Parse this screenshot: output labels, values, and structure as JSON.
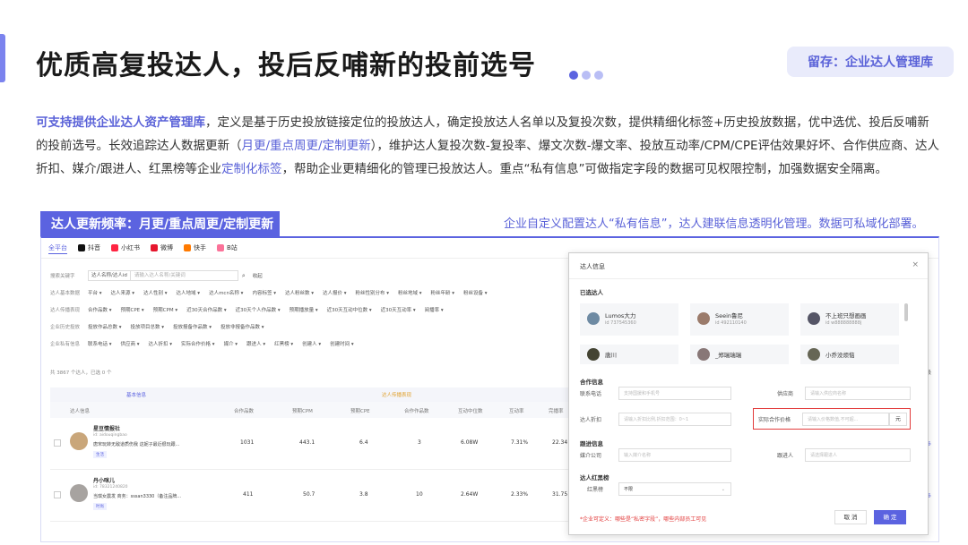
{
  "header": {
    "title": "优质高复投达人，投后反哺新的投前选号",
    "tag": "留存：企业达人管理库",
    "accent_color": "#5b63e0"
  },
  "description": {
    "p1_hl": "可支持提供企业达人资产管理库",
    "p1": "，定义是基于历史投放链接定位的投放达人，确定投放达人名单以及复投次数，提供精细化标签+历史投放数据，优中选优、投后反哺新的投前选号。长效追踪达人数据更新（",
    "p2_hl": "月更/重点周更/定制更新",
    "p2": "），维护达人复投次数-复投率、爆文次数-爆文率、投放互动率/CPM/CPE评估效果好坏、合作供应商、达人折扣、媒介/跟进人、红黑榜等企业",
    "p3_hl": "定制化标签",
    "p3": "，帮助企业更精细化的管理已投放达人。重点“私有信息”可做指定字段的数据可见权限控制，加强数据安全隔离。"
  },
  "section_label": "达人更新频率：月更/重点周更/定制更新",
  "right_caption": "企业自定义配置达人“私有信息”，达人建联信息透明化管理。数据可私域化部署。",
  "app": {
    "tabs": [
      {
        "label": "全平台",
        "icon": "all-icon",
        "color": ""
      },
      {
        "label": "抖音",
        "icon": "douyin-icon",
        "color": "#111111"
      },
      {
        "label": "小红书",
        "icon": "xiaohongshu-icon",
        "color": "#ff2442"
      },
      {
        "label": "微博",
        "icon": "weibo-icon",
        "color": "#e6162d"
      },
      {
        "label": "快手",
        "icon": "kuaishou-icon",
        "color": "#ff7a00"
      },
      {
        "label": "B站",
        "icon": "bilibili-icon",
        "color": "#fb7299"
      }
    ],
    "search": {
      "row_label": "搜索关键字",
      "select": "达人名称/达人id",
      "placeholder": "请输入达人名称/关键词",
      "advanced": "收起"
    },
    "filter_rows": [
      {
        "label": "达人基本数据",
        "items": [
          "平台",
          "达人来源",
          "达人性别",
          "达人地域",
          "达人mcn名称",
          "内容标签",
          "达人粉丝数",
          "达人报价",
          "粉丝性别分布",
          "粉丝地域",
          "粉丝年龄",
          "粉丝设备"
        ]
      },
      {
        "label": "达人传播表现",
        "items": [
          "合作品数",
          "预期CPE",
          "预期CPM",
          "近30天合作品数",
          "近30天个人作品数",
          "预期播放量",
          "近30天互动中位数",
          "近30天互动率",
          "阅播率"
        ]
      },
      {
        "label": "企业历史投放",
        "items": [
          "投放作品总数",
          "投放项目总数",
          "投放报备作品数",
          "投放非报备作品数"
        ]
      },
      {
        "label": "企业私有信息",
        "items": [
          "联系电话",
          "供应商",
          "达人折扣",
          "实际合作价格",
          "媒介",
          "跟进人",
          "红黑榜",
          "创建人",
          "创建时间"
        ]
      }
    ],
    "count": "共 3867 个达人，已选 0 个",
    "table": {
      "group1": "基本信息",
      "group2": "达人传播表现",
      "headers": [
        "达人信息",
        "合作品数",
        "预期CPM",
        "预期CPE",
        "合作作品数",
        "互动中位数",
        "互动率",
        "完播率"
      ],
      "rows": [
        {
          "name": "星豆情报社",
          "id": "id: aidouqingbao",
          "bio": "唐宋玩转无敌道质伤我 这妮子最近很玩跟...",
          "badge": "生活",
          "values": [
            "1031",
            "443.1",
            "6.4",
            "3",
            "6.08W",
            "7.31%",
            "22.34"
          ]
        },
        {
          "name": "丹小咪儿",
          "id": "id: 78321240820",
          "bio": "当琪女震发 商务：sssan3330（备注品牌...",
          "badge": "时尚",
          "values": [
            "411",
            "50.7",
            "3.8",
            "10",
            "2.64W",
            "2.33%",
            "31.75"
          ]
        }
      ],
      "more_label": "更多",
      "side_label": "字段"
    }
  },
  "modal": {
    "title": "达人信息",
    "close": "×",
    "selected_title": "已选达人",
    "kols": [
      {
        "name": "Lumos大力",
        "id": "id 737545360"
      },
      {
        "name": "Seein鲁尼",
        "id": "id 492110140"
      },
      {
        "name": "不上班只想画画",
        "id": "id w888888888j"
      },
      {
        "name": "唐川",
        "id": ""
      },
      {
        "name": "_郑瑞瑞瑞",
        "id": ""
      },
      {
        "name": "小乔没烦恼",
        "id": ""
      }
    ],
    "coop_title": "合作信息",
    "phone_label": "联系电话",
    "phone_placeholder": "支持国援和手机号",
    "supplier_label": "供应商",
    "supplier_placeholder": "请输入供应商名称",
    "discount_label": "达人折扣",
    "discount_placeholder": "请输入折扣比例,折扣范围：0~1",
    "price_label": "实际合作价格",
    "price_placeholder": "请输入价格数值,不可超...",
    "price_unit": "元",
    "follow_title": "跟进信息",
    "media_label": "媒介公司",
    "media_placeholder": "输入媒介名称",
    "follower_label": "跟进人",
    "follower_placeholder": "请选择跟进人",
    "rb_title": "达人红黑榜",
    "rb_label": "红黑榜",
    "rb_value": "不限",
    "note": "*企业可定义：哪些是“私密字段”，哪些内部员工可见",
    "cancel": "取 消",
    "ok": "确 定",
    "highlight_color": "#e23b3b"
  }
}
